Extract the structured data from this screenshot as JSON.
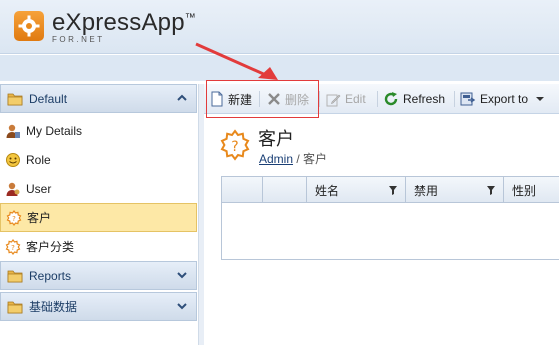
{
  "app": {
    "title": "eXpressApp",
    "tm": "™",
    "subtitle": "FOR.NET"
  },
  "sidebar": {
    "groups": [
      {
        "label": "Default",
        "expanded": true
      },
      {
        "label": "Reports",
        "expanded": false
      },
      {
        "label": "基础数据",
        "expanded": false
      }
    ],
    "items": [
      {
        "label": "My Details",
        "icon": "user-details-icon"
      },
      {
        "label": "Role",
        "icon": "role-icon"
      },
      {
        "label": "User",
        "icon": "user-icon"
      },
      {
        "label": "客户",
        "icon": "customer-icon",
        "selected": true
      },
      {
        "label": "客户分类",
        "icon": "customer-category-icon"
      }
    ]
  },
  "toolbar": {
    "new_label": "新建",
    "delete_label": "删除",
    "edit_label": "Edit",
    "refresh_label": "Refresh",
    "export_label": "Export to"
  },
  "main": {
    "title": "客户",
    "breadcrumb": {
      "link": "Admin",
      "separator": " / ",
      "current": "客户"
    },
    "grid": {
      "columns": [
        "",
        "",
        "姓名",
        "禁用",
        "性别"
      ]
    }
  },
  "colors": {
    "accent_orange": "#e8891c",
    "selected_row": "#fde8a6",
    "highlight_red": "#e23b3b",
    "header_blue": "#dce7f3"
  }
}
